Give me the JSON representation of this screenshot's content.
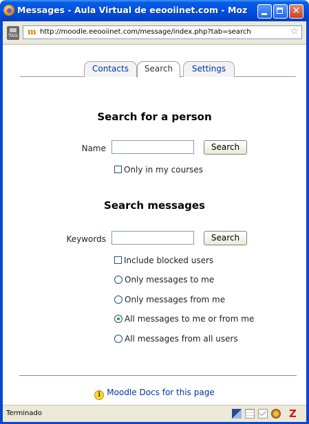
{
  "window": {
    "title": "Messages - Aula Virtual de eeooiinet.com - Mozilla ...",
    "url": "http://moodle.eeooiinet.com/message/index.php?tab=search"
  },
  "tabs": {
    "contacts": "Contacts",
    "search": "Search",
    "settings": "Settings"
  },
  "person_search": {
    "heading": "Search for a person",
    "name_label": "Name",
    "name_value": "",
    "button": "Search",
    "only_my_courses": "Only in my courses"
  },
  "message_search": {
    "heading": "Search messages",
    "keywords_label": "Keywords",
    "keywords_value": "",
    "button": "Search",
    "include_blocked": "Include blocked users",
    "radios": [
      {
        "label": "Only messages to me",
        "selected": false
      },
      {
        "label": "Only messages from me",
        "selected": false
      },
      {
        "label": "All messages to me or from me",
        "selected": true
      },
      {
        "label": "All messages from all users",
        "selected": false
      }
    ]
  },
  "footer": {
    "docs_link": "Moodle Docs for this page"
  },
  "statusbar": {
    "text": "Terminado"
  },
  "icons": {
    "app": "firefox-icon",
    "tag": "tag-icon",
    "site": "moodle-favicon",
    "bookmark": "star-icon",
    "info": "info-icon",
    "zotero": "zotero-icon"
  },
  "colors": {
    "titlebar": "#0055e5",
    "link": "#0033aa",
    "chrome": "#ece9d8",
    "close_button": "#c8401f"
  }
}
